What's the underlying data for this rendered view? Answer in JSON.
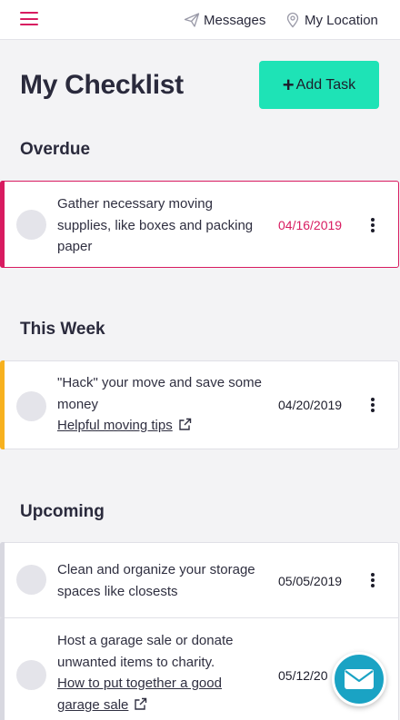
{
  "nav": {
    "messages_label": "Messages",
    "location_label": "My Location",
    "menu_icon": "hamburger-menu-icon",
    "messages_icon": "paper-plane-icon",
    "location_icon": "map-pin-icon"
  },
  "header": {
    "title": "My Checklist",
    "add_task_label": "Add Task",
    "add_task_icon": "+"
  },
  "colors": {
    "accent_pink": "#d81b60",
    "add_button": "#1ee3b6",
    "this_week_bar": "#f7b11f",
    "upcoming_bar": "#d8d8e0",
    "chat_button": "#1aa3c4"
  },
  "sections": {
    "overdue": {
      "title": "Overdue",
      "tasks": [
        {
          "text": "Gather necessary moving supplies, like boxes and packing paper",
          "date": "04/16/2019"
        }
      ]
    },
    "this_week": {
      "title": "This Week",
      "tasks": [
        {
          "text": "\"Hack\" your move and save some money",
          "link": "Helpful moving tips",
          "date": "04/20/2019"
        }
      ]
    },
    "upcoming": {
      "title": "Upcoming",
      "tasks": [
        {
          "text": "Clean and organize your storage spaces like closests",
          "date": "05/05/2019"
        },
        {
          "text": "Host a garage sale or donate unwanted items to charity.",
          "link": "How to put together a good garage sale",
          "date": "05/12/20"
        }
      ]
    }
  },
  "chat": {
    "icon": "envelope-icon"
  }
}
